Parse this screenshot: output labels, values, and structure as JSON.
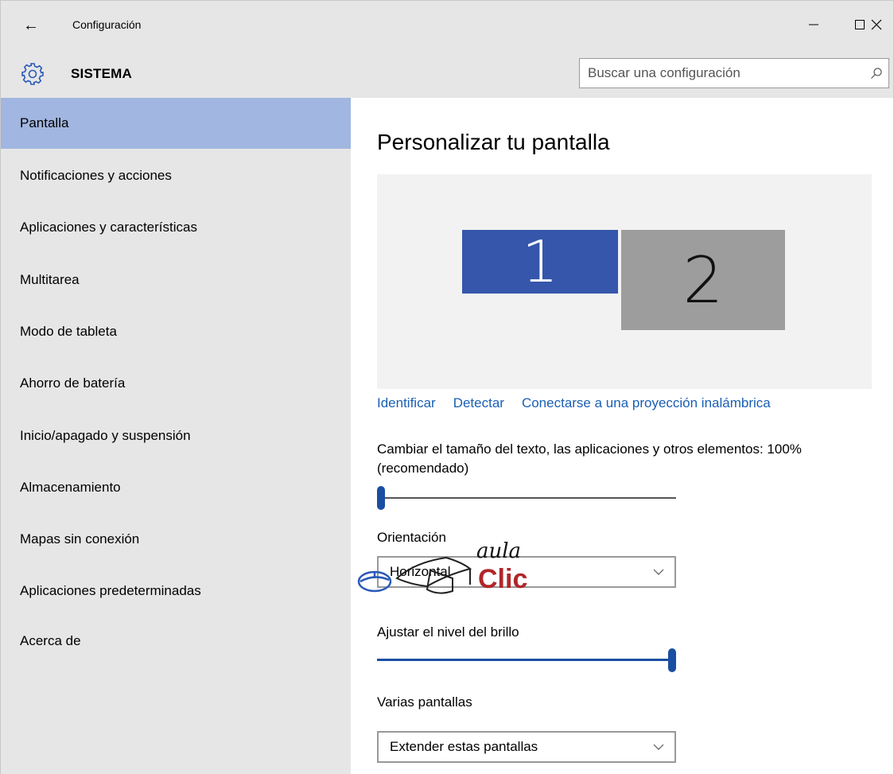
{
  "window": {
    "title": "Configuración",
    "back_icon": "←",
    "controls": {
      "minimize": "—",
      "maximize": "☐",
      "close": "✕"
    }
  },
  "header": {
    "section_title": "SISTEMA",
    "search_placeholder": "Buscar una configuración",
    "search_value": ""
  },
  "sidebar": {
    "items": [
      {
        "label": "Pantalla",
        "active": true
      },
      {
        "label": "Notificaciones y acciones",
        "active": false
      },
      {
        "label": "Aplicaciones y características",
        "active": false
      },
      {
        "label": "Multitarea",
        "active": false
      },
      {
        "label": "Modo de tableta",
        "active": false
      },
      {
        "label": "Ahorro de batería",
        "active": false
      },
      {
        "label": "Inicio/apagado y suspensión",
        "active": false
      },
      {
        "label": "Almacenamiento",
        "active": false
      },
      {
        "label": "Mapas sin conexión",
        "active": false
      },
      {
        "label": "Aplicaciones predeterminadas",
        "active": false
      },
      {
        "label": "Acerca de",
        "active": false
      }
    ]
  },
  "main": {
    "title": "Personalizar tu pantalla",
    "monitors": [
      {
        "number": "1",
        "selected": true
      },
      {
        "number": "2",
        "selected": false
      }
    ],
    "links": {
      "identify": "Identificar",
      "detect": "Detectar",
      "wireless": "Conectarse a una proyección inalámbrica"
    },
    "scale": {
      "label_line1": "Cambiar el tamaño del texto, las aplicaciones y otros elementos: 100%",
      "label_line2": "(recomendado)",
      "level": 0
    },
    "orientation": {
      "label": "Orientación",
      "value": "Horizontal"
    },
    "brightness": {
      "label": "Ajustar el nivel del brillo",
      "level": 1
    },
    "multiple_displays": {
      "label": "Varias pantallas",
      "value": "Extender estas pantallas"
    }
  },
  "logo": {
    "top": "aula",
    "bottom": "Clic"
  },
  "colors": {
    "accent": "#3556ab",
    "active_nav": "#a1b6e0",
    "link": "#1a5fb4",
    "logo_red": "#b0272a"
  }
}
